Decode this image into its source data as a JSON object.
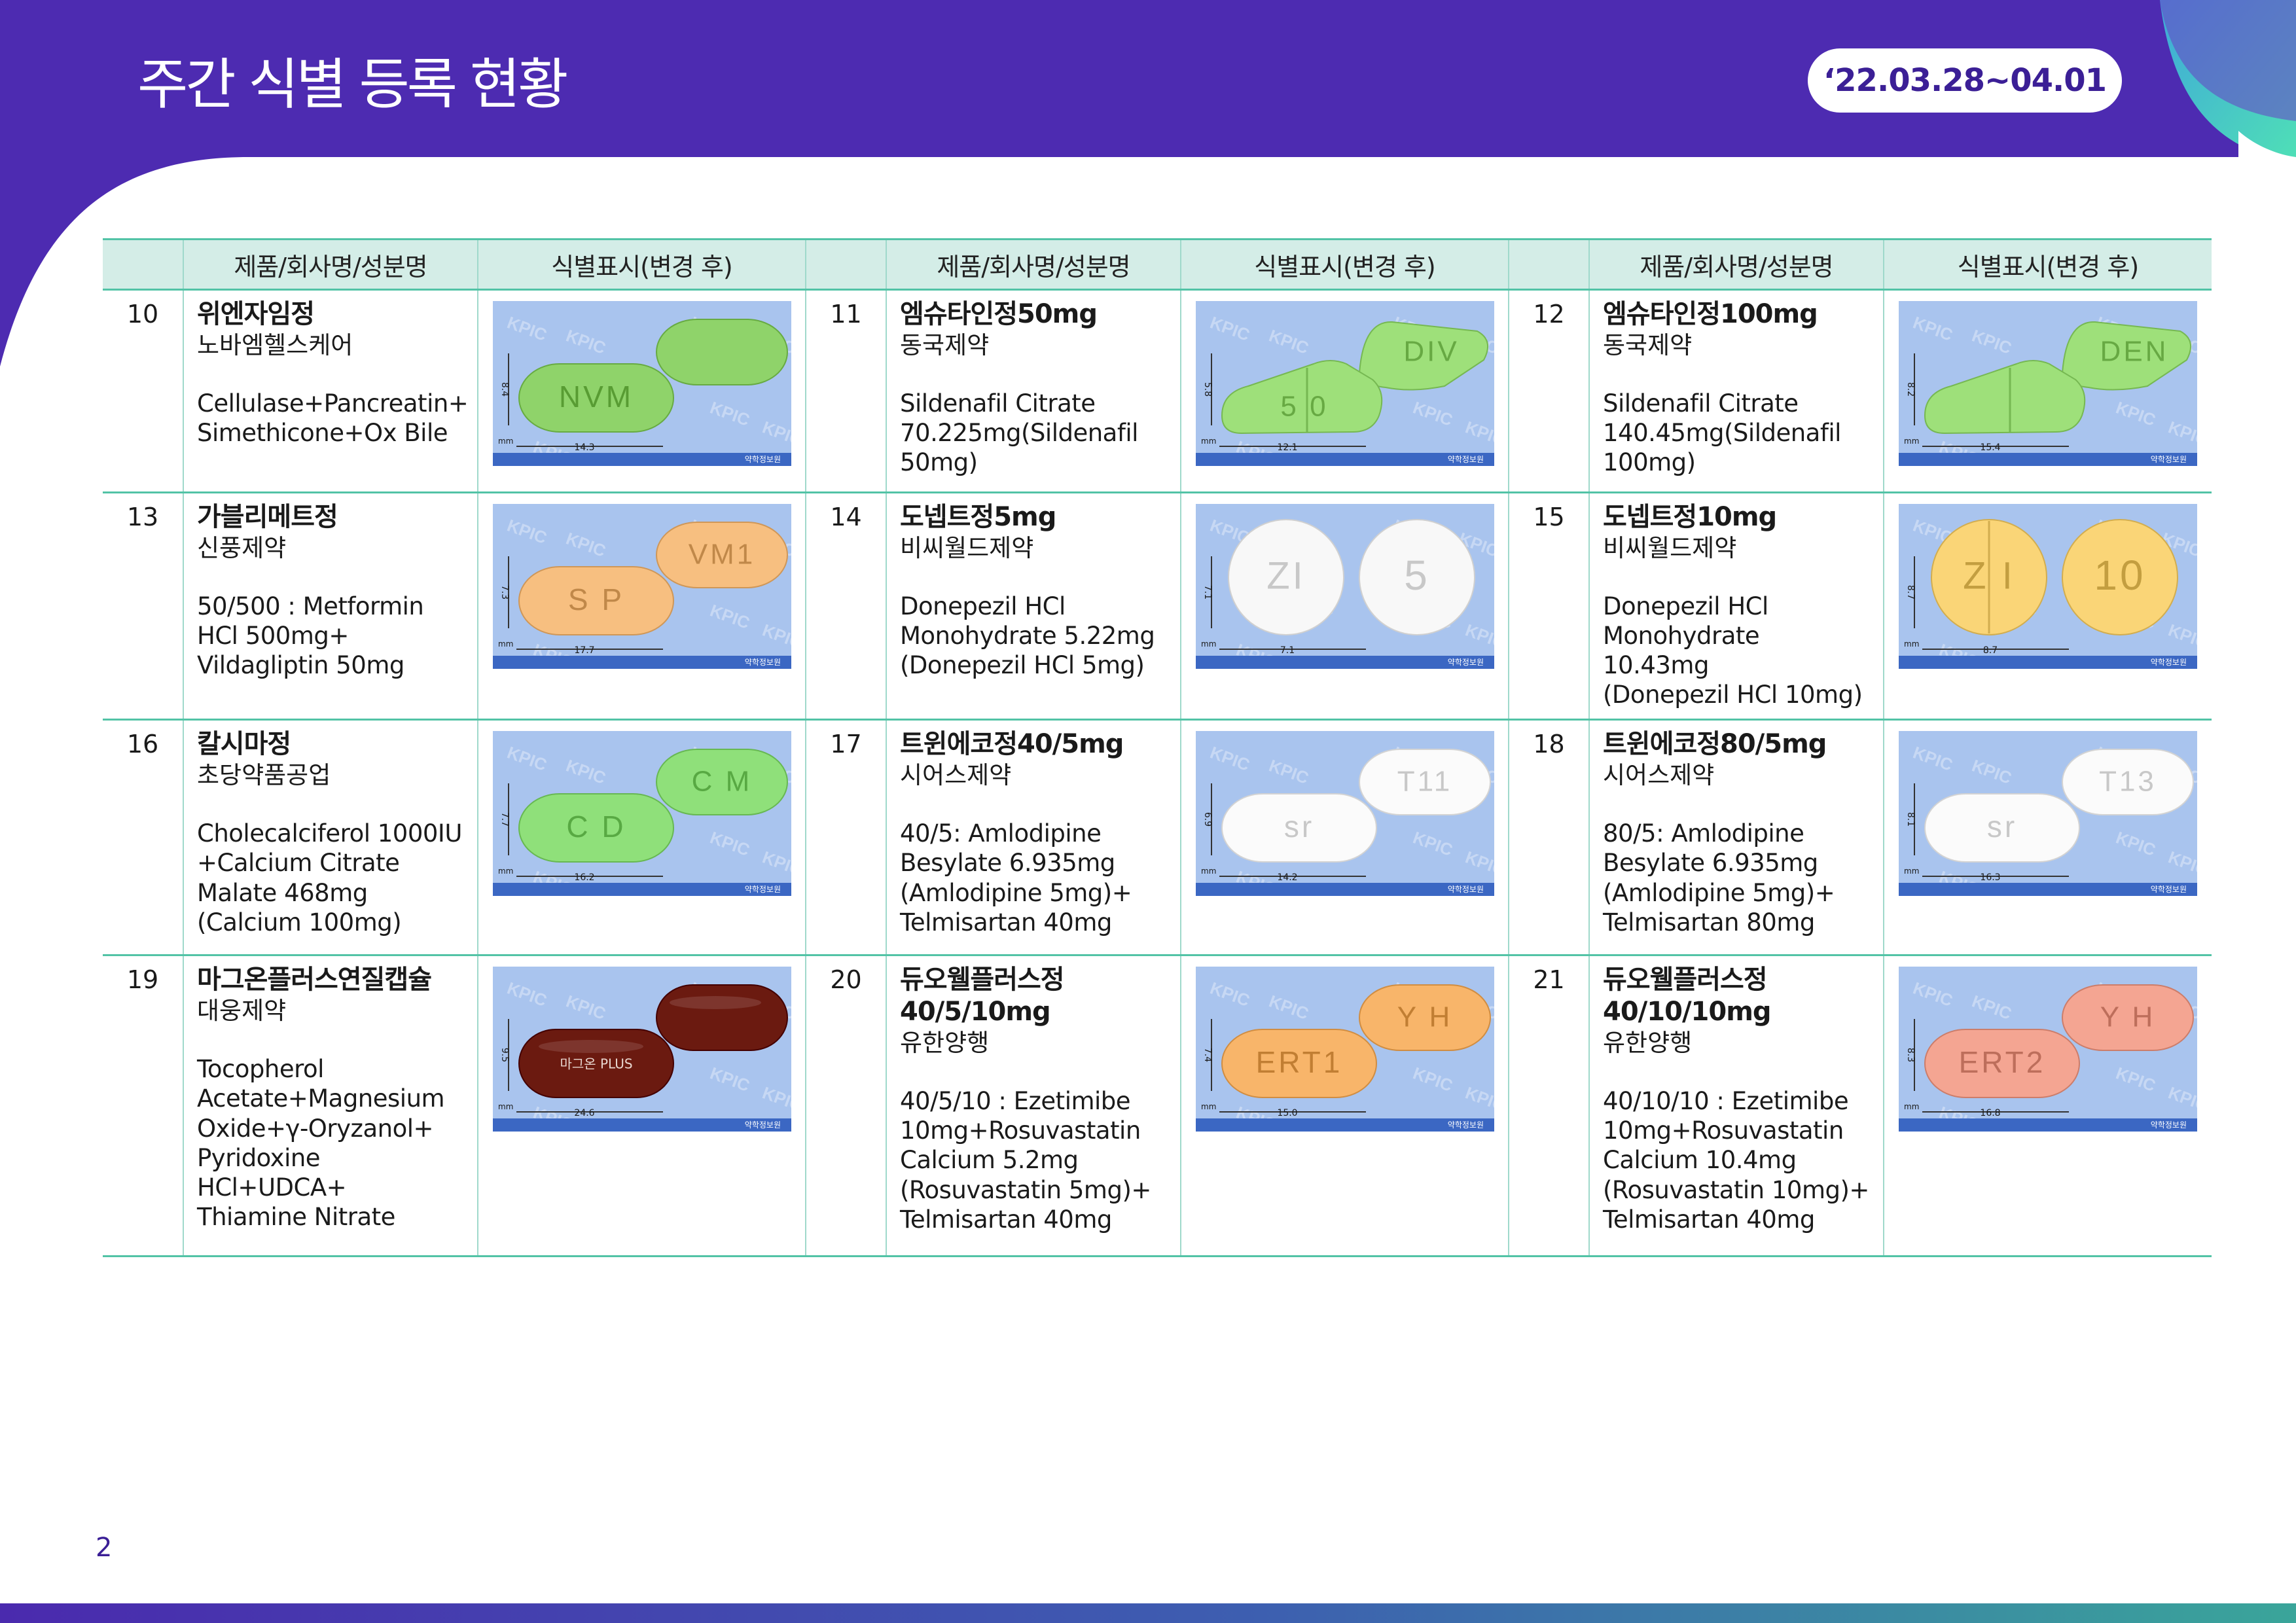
{
  "header": {
    "title": "주간 식별 등록 현황",
    "date_range": "‘22.03.28~04.01"
  },
  "table": {
    "headers": [
      "",
      "제품/회사명/성분명",
      "식별표시(변경 후)",
      "",
      "제품/회사명/성분명",
      "식별표시(변경 후)",
      "",
      "제품/회사명/성분명",
      "식별표시(변경 후)"
    ],
    "rows": [
      [
        {
          "no": "10",
          "name": "위엔자임정",
          "company": "노바엠헬스케어",
          "ingredient": "Cellulase+Pancreatin+\nSimethicone+Ox Bile",
          "image": {
            "shape": "oval",
            "color": "#8fd36a",
            "front": "NVM",
            "back": "",
            "split": "none",
            "height_mm": "8.4",
            "length_mm": "14.3"
          }
        },
        {
          "no": "11",
          "name": "엠슈타인정50mg",
          "company": "동국제약",
          "ingredient": "Sildenafil Citrate\n70.225mg(Sildenafil\n50mg)",
          "image": {
            "shape": "triangle",
            "color": "#9ee07a",
            "front": "5 0",
            "back": "DIV",
            "split": "vertical",
            "height_mm": "5.8",
            "length_mm": "12.1"
          }
        },
        {
          "no": "12",
          "name": "엠슈타인정100mg",
          "company": "동국제약",
          "ingredient": "Sildenafil Citrate\n140.45mg(Sildenafil\n100mg)",
          "image": {
            "shape": "triangle",
            "color": "#9ee07a",
            "front": "",
            "back": "DEN",
            "split": "vertical",
            "height_mm": "8.2",
            "length_mm": "15.4"
          }
        }
      ],
      [
        {
          "no": "13",
          "name": "가블리메트정",
          "company": "신풍제약",
          "ingredient": "50/500 : Metformin\nHCl 500mg+\nVildagliptin 50mg",
          "image": {
            "shape": "capsule",
            "color": "#f7bf80",
            "front": "S P",
            "back": "VM1",
            "split": "none",
            "height_mm": "7.3",
            "length_mm": "17.7"
          }
        },
        {
          "no": "14",
          "name": "도넵트정5mg",
          "company": "비씨월드제약",
          "ingredient": "Donepezil HCl\nMonohydrate 5.22mg\n(Donepezil HCl 5mg)",
          "image": {
            "shape": "round",
            "color": "#f8f8f8",
            "front": "ZI",
            "back": "5",
            "split": "none",
            "height_mm": "7.1",
            "length_mm": "7.1"
          }
        },
        {
          "no": "15",
          "name": "도넵트정10mg",
          "company": "비씨월드제약",
          "ingredient": "Donepezil HCl\nMonohydrate 10.43mg\n(Donepezil HCl 10mg)",
          "image": {
            "shape": "round",
            "color": "#fad577",
            "front": "Z I",
            "back": "10",
            "split": "vertical",
            "height_mm": "8.7",
            "length_mm": "8.7"
          }
        }
      ],
      [
        {
          "no": "16",
          "name": "칼시마정",
          "company": "초당약품공업",
          "ingredient": "Cholecalciferol 1000IU\n+Calcium Citrate\nMalate 468mg\n(Calcium 100mg)",
          "image": {
            "shape": "oval",
            "color": "#8fe07a",
            "front": "C D",
            "back": "C M",
            "split": "none",
            "height_mm": "7.7",
            "length_mm": "16.2"
          }
        },
        {
          "no": "17",
          "name": "트윈에코정40/5mg",
          "company": "시어스제약",
          "ingredient": "40/5: Amlodipine\nBesylate 6.935mg\n(Amlodipine 5mg)+\nTelmisartan 40mg",
          "image": {
            "shape": "oval",
            "color": "#fbfbfb",
            "front": "sr",
            "back": "T11",
            "split": "none",
            "height_mm": "6.9",
            "length_mm": "14.2"
          }
        },
        {
          "no": "18",
          "name": "트윈에코정80/5mg",
          "company": "시어스제약",
          "ingredient": "80/5: Amlodipine\nBesylate 6.935mg\n(Amlodipine 5mg)+\nTelmisartan 80mg",
          "image": {
            "shape": "oval",
            "color": "#fbfbfb",
            "front": "sr",
            "back": "T13",
            "split": "none",
            "height_mm": "8.1",
            "length_mm": "16.3"
          }
        }
      ],
      [
        {
          "no": "19",
          "name": "마그온플러스연질캡슐",
          "company": "대웅제약",
          "ingredient": "Tocopherol\nAcetate+Magnesium\nOxide+γ-Oryzanol+\nPyridoxine HCl+UDCA+\nThiamine Nitrate",
          "image": {
            "shape": "softgel",
            "color": "#6b1a10",
            "front": "마그온 PLUS",
            "back": "",
            "split": "none",
            "height_mm": "9.5",
            "length_mm": "24.6"
          }
        },
        {
          "no": "20",
          "name": "듀오웰플러스정\n40/5/10mg",
          "company": "유한양행",
          "ingredient": "40/5/10 : Ezetimibe\n10mg+Rosuvastatin\nCalcium 5.2mg\n(Rosuvastatin 5mg)+\nTelmisartan 40mg",
          "image": {
            "shape": "oval",
            "color": "#f8b56a",
            "front": "ERT1",
            "back": "Y H",
            "split": "none",
            "height_mm": "7.4",
            "length_mm": "15.0"
          }
        },
        {
          "no": "21",
          "name": "듀오웰플러스정\n40/10/10mg",
          "company": "유한양행",
          "ingredient": "40/10/10 : Ezetimibe\n10mg+Rosuvastatin\nCalcium 10.4mg\n(Rosuvastatin 10mg)+\nTelmisartan 40mg",
          "image": {
            "shape": "oval",
            "color": "#f4a592",
            "front": "ERT2",
            "back": "Y H",
            "split": "none",
            "height_mm": "8.3",
            "length_mm": "16.8"
          }
        }
      ]
    ]
  },
  "photo_watermark": "KPIC",
  "photo_unit": "mm",
  "photo_caption": "약학정보원",
  "page_number": "2",
  "colors": {
    "header": "#4d2bb1",
    "accent_teal": "#52c3a6",
    "header_cell": "#d4ede7",
    "photo_bg": "#a9c4ee"
  }
}
